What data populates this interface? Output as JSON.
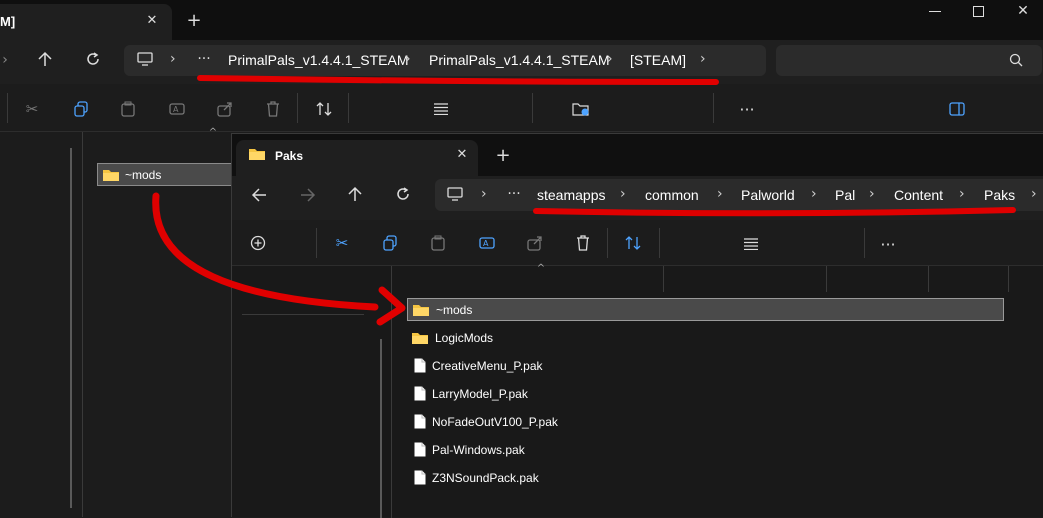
{
  "back_window": {
    "tab_title": "M]",
    "breadcrumbs": [
      "PrimalPals_v1.4.4.1_STEAM",
      "PrimalPals_v1.4.4.1_STEAM",
      "[STEAM]"
    ],
    "folder_item": "~mods"
  },
  "front_window": {
    "tab_title": "Paks",
    "breadcrumbs": [
      "steamapps",
      "common",
      "Palworld",
      "Pal",
      "Content",
      "Paks"
    ],
    "files": [
      {
        "name": "~mods",
        "type": "folder",
        "selected": true
      },
      {
        "name": "LogicMods",
        "type": "folder",
        "selected": false
      },
      {
        "name": "CreativeMenu_P.pak",
        "type": "file",
        "selected": false
      },
      {
        "name": "LarryModel_P.pak",
        "type": "file",
        "selected": false
      },
      {
        "name": "NoFadeOutV100_P.pak",
        "type": "file",
        "selected": false
      },
      {
        "name": "Pal-Windows.pak",
        "type": "file",
        "selected": false
      },
      {
        "name": "Z3NSoundPack.pak",
        "type": "file",
        "selected": false
      }
    ]
  },
  "colors": {
    "annotation": "#e00000",
    "folder": "#f5c542",
    "selection": "#4a4a4a"
  }
}
